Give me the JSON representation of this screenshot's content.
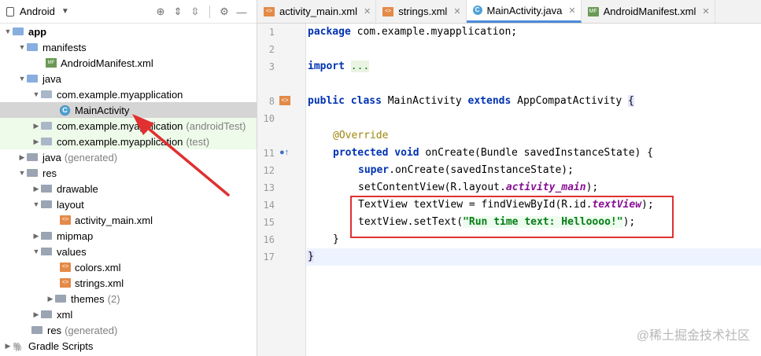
{
  "project_panel": {
    "title": "Android",
    "tree": [
      {
        "label": "app",
        "suffix": ""
      },
      {
        "label": "manifests",
        "suffix": ""
      },
      {
        "label": "AndroidManifest.xml",
        "suffix": ""
      },
      {
        "label": "java",
        "suffix": ""
      },
      {
        "label": "com.example.myapplication",
        "suffix": ""
      },
      {
        "label": "MainActivity",
        "suffix": ""
      },
      {
        "label": "com.example.myapplication",
        "suffix": "(androidTest)"
      },
      {
        "label": "com.example.myapplication",
        "suffix": "(test)"
      },
      {
        "label": "java",
        "suffix": "(generated)"
      },
      {
        "label": "res",
        "suffix": ""
      },
      {
        "label": "drawable",
        "suffix": ""
      },
      {
        "label": "layout",
        "suffix": ""
      },
      {
        "label": "activity_main.xml",
        "suffix": ""
      },
      {
        "label": "mipmap",
        "suffix": ""
      },
      {
        "label": "values",
        "suffix": ""
      },
      {
        "label": "colors.xml",
        "suffix": ""
      },
      {
        "label": "strings.xml",
        "suffix": ""
      },
      {
        "label": "themes",
        "suffix": "(2)"
      },
      {
        "label": "xml",
        "suffix": ""
      },
      {
        "label": "res",
        "suffix": "(generated)"
      },
      {
        "label": "Gradle Scripts",
        "suffix": ""
      }
    ]
  },
  "tabs": [
    {
      "label": "activity_main.xml",
      "icon": "xml-file-icon"
    },
    {
      "label": "strings.xml",
      "icon": "xml-file-icon"
    },
    {
      "label": "MainActivity.java",
      "icon": "class-icon"
    },
    {
      "label": "AndroidManifest.xml",
      "icon": "manifest-icon"
    }
  ],
  "active_tab": "MainActivity.java",
  "line_numbers": [
    "1",
    "2",
    "3",
    "8",
    "10",
    "11",
    "12",
    "13",
    "14",
    "15",
    "16",
    "17"
  ],
  "code": {
    "l1": {
      "kw": "package",
      "rest": " com.example.myapplication;"
    },
    "l3": {
      "kw": "import",
      "rest": "..."
    },
    "l8": {
      "kw1": "public",
      "kw2": "class",
      "name": "MainActivity",
      "kw3": "extends",
      "parent": "AppCompatActivity",
      "brace": "{"
    },
    "l10": {
      "annotation": "@Override"
    },
    "l11": {
      "kw1": "protected",
      "kw2": "void",
      "rest": " onCreate(Bundle savedInstanceState) {"
    },
    "l12": {
      "kw": "super",
      "rest": ".onCreate(savedInstanceState);"
    },
    "l13": {
      "pre": "setContentView(R.layout.",
      "field": "activity_main",
      "post": ");"
    },
    "l14": {
      "pre": "TextView textView = findViewById(R.id.",
      "field": "textView",
      "post": ");"
    },
    "l15": {
      "pre": "textView.setText(",
      "str": "\"Run time text: Helloooo!\"",
      "post": ");"
    },
    "l16": {
      "text": "}"
    },
    "l17": {
      "text": "}"
    }
  },
  "watermark": "@稀土掘金技术社区",
  "colors": {
    "highlight_box": "#e0302f",
    "arrow": "#e0302f"
  }
}
